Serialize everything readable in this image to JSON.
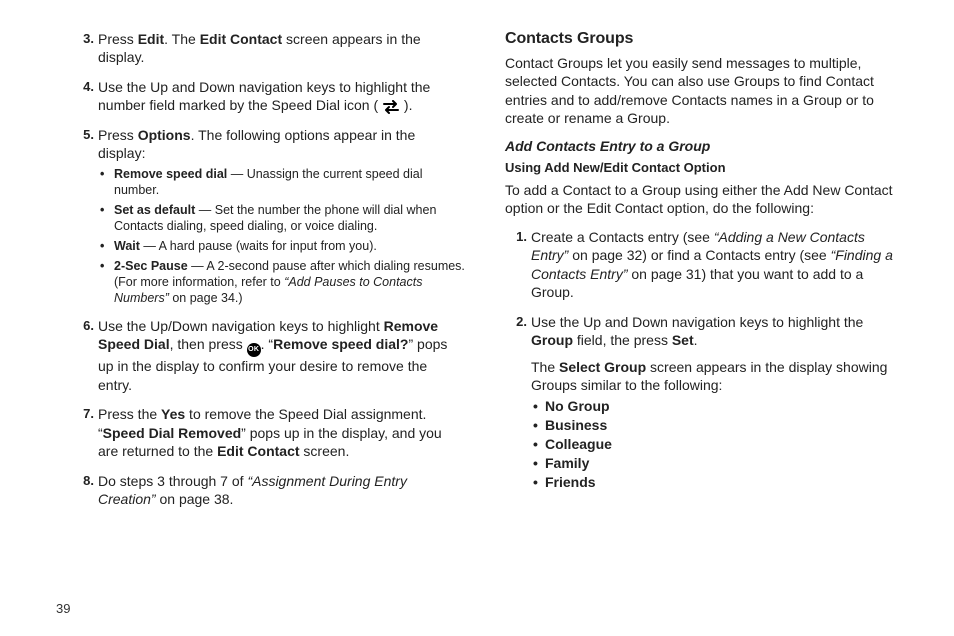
{
  "page_number": "39",
  "left": {
    "steps_start": 2,
    "s3": {
      "t1": "Press ",
      "b1": "Edit",
      "t2": ". The ",
      "b2": "Edit Contact",
      "t3": " screen appears in the display."
    },
    "s4": {
      "t1": "Use the Up and Down navigation keys to highlight the number field marked by the Speed Dial icon ( ",
      "t2": " )."
    },
    "s5": {
      "t1": "Press ",
      "b1": "Options",
      "t2": ". The following options appear in the display:",
      "opts": [
        {
          "b": "Remove speed dial",
          "t": " — Unassign the current speed dial number."
        },
        {
          "b": "Set as default",
          "t": " — Set the number the phone will dial when Contacts dialing, speed dialing, or voice dialing."
        },
        {
          "b": "Wait",
          "t": " — A hard pause (waits for input from you)."
        },
        {
          "b": "2-Sec Pause",
          "t": " — A 2-second pause after which dialing resumes. (For more information, refer to ",
          "ref": "“Add Pauses to Contacts Numbers”",
          "t2": "  on page 34.)"
        }
      ]
    },
    "s6": {
      "t1": "Use the Up/Down navigation keys to highlight ",
      "b1": "Remove Speed Dial",
      "t2": ", then press ",
      "ok": "OK",
      "t3": ". “",
      "b2": "Remove speed dial?",
      "t4": "” pops up in the display to confirm your desire to remove the entry."
    },
    "s7": {
      "t1": "Press the ",
      "b1": "Yes",
      "t2": " to remove the Speed Dial assignment. “",
      "b2": "Speed Dial Removed",
      "t3": "” pops up in the display, and you are returned to the ",
      "b3": "Edit Contact",
      "t4": " screen."
    },
    "s8": {
      "t1": "Do steps 3 through 7 of ",
      "ref": "“Assignment During Entry Creation”",
      "t2": "  on page 38."
    }
  },
  "right": {
    "section_title": "Contacts Groups",
    "intro": "Contact Groups let you easily send messages to multiple, selected Contacts. You can also use Groups to find Contact entries and to add/remove Contacts names in a Group or to create or rename a Group.",
    "sub_title": "Add Contacts Entry to a Group",
    "subsub_title": "Using Add New/Edit Contact Option",
    "lead": "To add a Contact to a Group using either the Add New Contact option or the Edit Contact option, do the following:",
    "s1": {
      "t1": "Create a Contacts entry (see ",
      "ref1": "“Adding a New Contacts Entry”",
      "t2": "  on page 32) or find a Contacts entry (see ",
      "ref2": "“Finding a Contacts Entry”",
      "t3": "  on page 31) that you want to add to a Group."
    },
    "s2": {
      "t1": "Use the Up and Down navigation keys to highlight the ",
      "b1": "Group",
      "t2": " field, the press ",
      "b2": "Set",
      "t3": ".",
      "p2a": "The ",
      "p2b": "Select Group",
      "p2c": " screen appears in the display showing Groups similar to the following:",
      "groups": [
        "No Group",
        "Business",
        "Colleague",
        "Family",
        "Friends"
      ]
    }
  }
}
